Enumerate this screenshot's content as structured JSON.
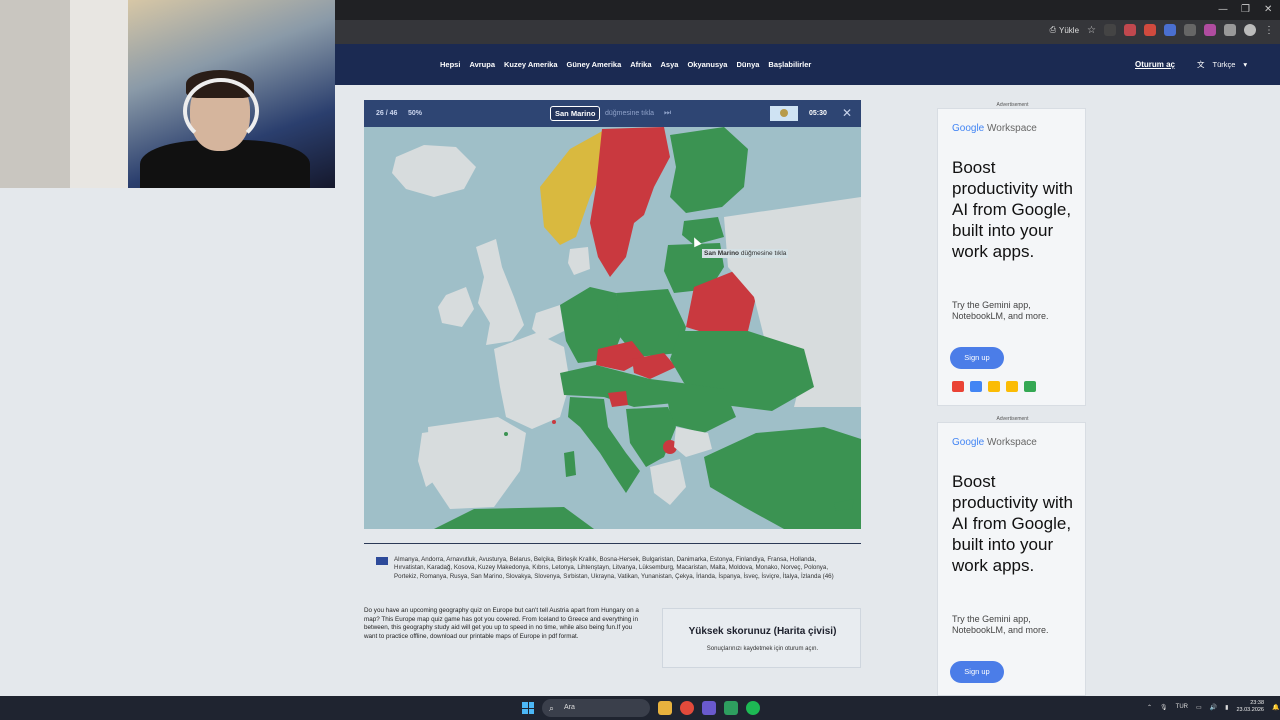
{
  "browser": {
    "load_label": "Yükle"
  },
  "nav": {
    "links": [
      "Hepsi",
      "Avrupa",
      "Kuzey Amerika",
      "Güney Amerika",
      "Afrika",
      "Asya",
      "Okyanusya",
      "Dünya",
      "Başlabilirler"
    ],
    "login": "Oturum aç",
    "language": "Türkçe"
  },
  "quiz": {
    "count": "26 / 46",
    "percent": "50%",
    "target": "San Marino",
    "prompt": "düğmesine tıkla",
    "timer": "05:30",
    "tooltip_country": "San Marino",
    "tooltip_text": "düğmesine tıkla"
  },
  "countries_list": "Almanya, Andorra, Arnavutluk, Avusturya, Belarus, Belçika, Birleşik Krallık, Bosna-Hersek, Bulgaristan, Danimarka, Estonya, Finlandiya, Fransa, Hollanda, Hırvatistan, Karadağ, Kosova, Kuzey Makedonya, Kıbrıs, Letonya, Lihtenştayn, Litvanya, Lüksemburg, Macaristan, Malta, Moldova, Monako, Norveç, Polonya, Portekiz, Romanya, Rusya, San Marino, Slovakya, Slovenya, Sırbistan, Ukrayna, Vatikan, Yunanistan, Çekya, İrlanda, İspanya, İsveç, İsviçre, İtalya, İzlanda (46)",
  "about_text": "Do you have an upcoming geography quiz on Europe but can't tell Austria apart from Hungary on a map? This Europe map quiz game has got you covered. From Iceland to Greece and everything in between, this geography study aid will get you up to speed in no time, while also being fun.If you want to practice offline, download our printable maps of Europe in pdf format.",
  "score": {
    "title": "Yüksek skorunuz (Harita çivisi)",
    "subtitle": "Sonuçlarınızı kaydetmek için oturum açın."
  },
  "ads": [
    {
      "label": "Advertisement",
      "brand_google": "Google",
      "brand_product": "Workspace",
      "headline": "Boost productivity with AI from Google, built into your work apps.",
      "body": "Try the Gemini app, NotebookLM, and more.",
      "cta": "Sign up"
    },
    {
      "label": "Advertisement",
      "brand_google": "Google",
      "brand_product": "Workspace",
      "headline": "Boost productivity with AI from Google, built into your work apps.",
      "body": "Try the Gemini app, NotebookLM, and more.",
      "cta": "Sign up"
    }
  ],
  "taskbar": {
    "search": "Ara",
    "lang": "TUR",
    "time": "23:38",
    "date": "23.03.2026"
  },
  "colors": {
    "correct": "#3b9352",
    "wrong": "#c9393f",
    "skipped": "#d9b93f",
    "unanswered": "#d7dcdd",
    "sea": "#9fbfc8",
    "navbar": "#1b2a52"
  }
}
